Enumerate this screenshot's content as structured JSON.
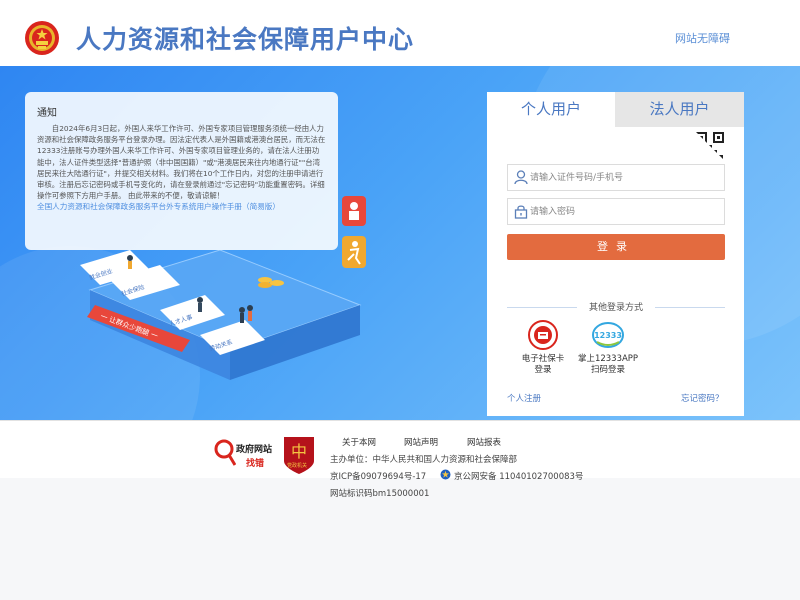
{
  "header": {
    "title": "人力资源和社会保障用户中心",
    "accessibility": "网站无障碍"
  },
  "notice": {
    "title": "通知",
    "body": "自2024年6月3日起，外国人来华工作许可、外国专家项目管理服务须统一经由人力资源和社会保障政务服务平台登录办理。因法定代表人是外国籍或港澳台居民，而无法在12333注册账号办理外国人来华工作许可、外国专家项目管理业务的，请在法人注册功能中，法人证件类型选择\"普通护照（非中国国籍）\"或\"港澳居民来往内地通行证\"\"台湾居民来往大陆通行证\"，并提交相关材料。我们将在10个工作日内，对您的注册申请进行审核。注册后忘记密码或手机号变化的，请在登录前通过\"忘记密码\"功能重置密码。详细操作可参照下方用户手册。 由此带来的不便，敬请谅解！",
    "link": "全国人力资源和社会保障政务服务平台外专系统用户操作手册（简易版）"
  },
  "illustration": {
    "ribbon": "一 让群众少跑腿 一",
    "cards": [
      "就业创业",
      "社会保险",
      "人才人事",
      "劳动关系"
    ]
  },
  "login": {
    "tabs": [
      "个人用户",
      "法人用户"
    ],
    "id_placeholder": "请输入证件号码/手机号",
    "password_placeholder": "请输入密码",
    "submit": "登录",
    "other_title": "其他登录方式",
    "alt_methods": [
      {
        "label": "电子社保卡\n登录"
      },
      {
        "label": "掌上12333APP\n扫码登录"
      }
    ],
    "register": "个人注册",
    "forgot": "忘记密码？"
  },
  "footer": {
    "badge_top": "政府网站",
    "badge_bottom": "找错",
    "party_text": "党政机关",
    "links": [
      "关于本网",
      "网站声明",
      "网站报表"
    ],
    "sponsor": "主办单位：中华人民共和国人力资源和社会保障部",
    "icp": "京ICP备09079694号-17",
    "police": "京公网安备 11040102700083号",
    "site_id": "网站标识码bm15000001"
  },
  "colors": {
    "brand_blue": "#4a78c2",
    "login_button": "#e36b3f",
    "banner": "#3b93f4"
  }
}
